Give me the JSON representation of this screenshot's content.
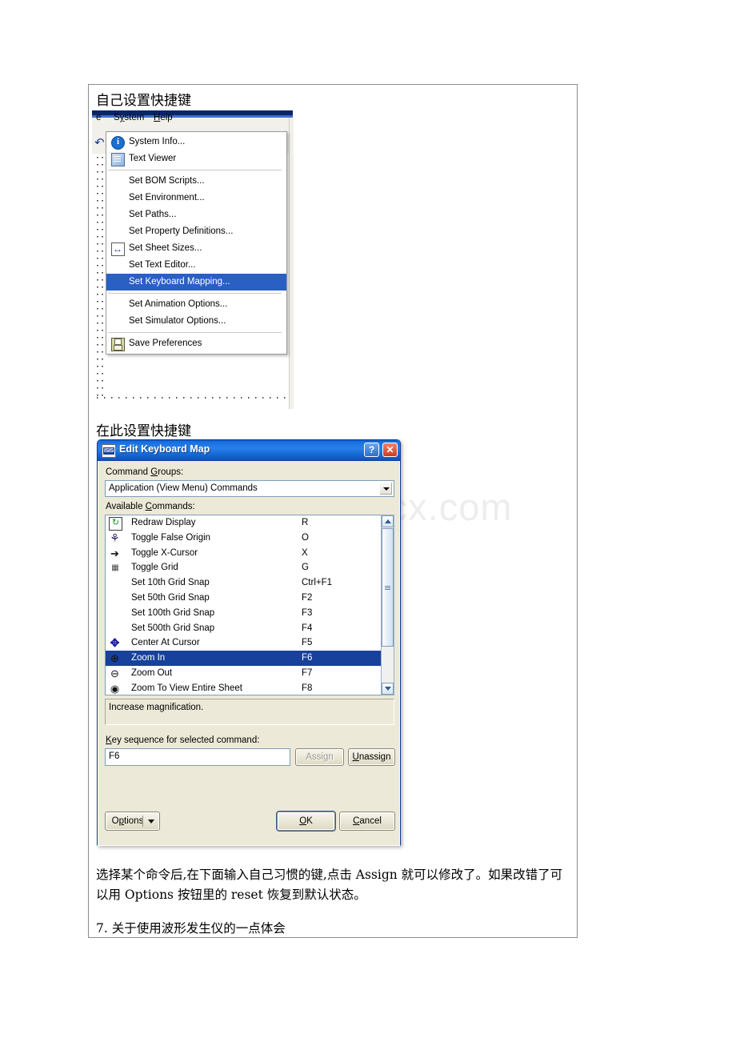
{
  "watermark": "www.bdocx.com",
  "document": {
    "heading_1": "自己设置快捷键",
    "heading_2": "在此设置快捷键",
    "paragraph": "选择某个命令后,在下面输入自己习惯的键,点击 Assign 就可以修改了。如果改错了可以用 Options 按钮里的 reset 恢复到默认状态。",
    "heading_3": "7. 关于使用波形发生仪的一点体会"
  },
  "menu_screenshot": {
    "menubar": [
      {
        "label": "e",
        "accel": ""
      },
      {
        "label": "System",
        "accel": "y"
      },
      {
        "label": "Help",
        "accel": "H"
      }
    ],
    "dropdown_items": [
      {
        "label": "System Info...",
        "icon": "info-icon",
        "separator_after": false
      },
      {
        "label": "Text Viewer",
        "icon": "text-viewer-icon",
        "separator_after": true
      },
      {
        "label": "Set BOM Scripts...",
        "icon": "",
        "separator_after": false
      },
      {
        "label": "Set Environment...",
        "icon": "",
        "separator_after": false
      },
      {
        "label": "Set Paths...",
        "icon": "",
        "separator_after": false
      },
      {
        "label": "Set Property Definitions...",
        "icon": "",
        "separator_after": false
      },
      {
        "label": "Set Sheet Sizes...",
        "icon": "sheet-sizes-icon",
        "separator_after": false
      },
      {
        "label": "Set Text Editor...",
        "icon": "",
        "separator_after": false
      },
      {
        "label": "Set Keyboard Mapping...",
        "icon": "",
        "separator_after": true,
        "selected": true
      },
      {
        "label": "Set Animation Options...",
        "icon": "",
        "separator_after": false
      },
      {
        "label": "Set Simulator Options...",
        "icon": "",
        "separator_after": true
      },
      {
        "label": "Save Preferences",
        "icon": "floppy-disk-icon",
        "separator_after": false
      }
    ]
  },
  "dialog": {
    "title": "Edit Keyboard Map",
    "title_icon": "isis-icon",
    "help_button": "?",
    "close_button": "✕",
    "command_groups_label": "Command Groups:",
    "command_groups_value": "Application (View Menu) Commands",
    "available_commands_label": "Available Commands:",
    "commands": [
      {
        "name": "Redraw Display",
        "key": "R",
        "icon": "redraw-icon"
      },
      {
        "name": "Toggle False Origin",
        "key": "O",
        "icon": "false-origin-icon"
      },
      {
        "name": "Toggle X-Cursor",
        "key": "X",
        "icon": "x-cursor-icon"
      },
      {
        "name": "Toggle Grid",
        "key": "G",
        "icon": "grid-icon"
      },
      {
        "name": "Set 10th Grid Snap",
        "key": "Ctrl+F1",
        "icon": ""
      },
      {
        "name": "Set 50th Grid Snap",
        "key": "F2",
        "icon": ""
      },
      {
        "name": "Set 100th Grid Snap",
        "key": "F3",
        "icon": ""
      },
      {
        "name": "Set 500th Grid Snap",
        "key": "F4",
        "icon": ""
      },
      {
        "name": "Center At Cursor",
        "key": "F5",
        "icon": "center-cursor-icon"
      },
      {
        "name": "Zoom In",
        "key": "F6",
        "icon": "zoom-in-icon",
        "selected": true
      },
      {
        "name": "Zoom Out",
        "key": "F7",
        "icon": "zoom-out-icon"
      },
      {
        "name": "Zoom To View Entire Sheet",
        "key": "F8",
        "icon": "zoom-fit-icon"
      }
    ],
    "description": "Increase magnification.",
    "key_sequence_label": "Key sequence for selected command:",
    "key_sequence_value": "F6",
    "assign_button": "Assign",
    "unassign_button": "Unassign",
    "options_button": "Options",
    "ok_button": "OK",
    "cancel_button": "Cancel"
  }
}
